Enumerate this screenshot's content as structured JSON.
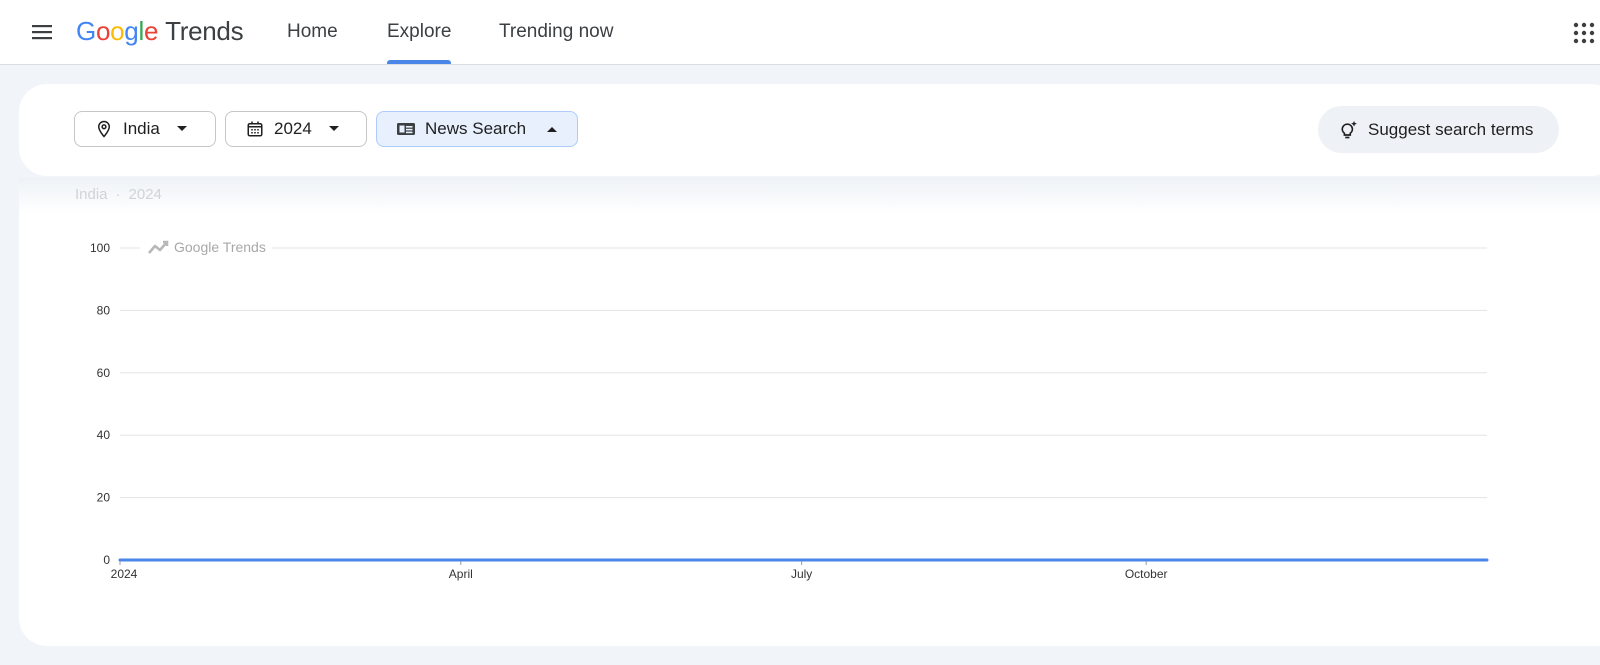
{
  "header": {
    "logo_brand": "Google",
    "logo_product": "Trends",
    "tabs": [
      {
        "label": "Home",
        "active": false
      },
      {
        "label": "Explore",
        "active": true
      },
      {
        "label": "Trending now",
        "active": false
      }
    ]
  },
  "filters": {
    "location": "India",
    "time_range": "2024",
    "search_type": "News Search",
    "suggest_label": "Suggest search terms"
  },
  "results": {
    "context_location": "India",
    "context_separator": "·",
    "context_time": "2024"
  },
  "chart_data": {
    "type": "line",
    "watermark": "Google Trends",
    "x_tick_labels": [
      "2024",
      "April",
      "July",
      "October"
    ],
    "x_tick_dates": [
      "2024-01-01",
      "2024-04-01",
      "2024-07-01",
      "2024-10-01"
    ],
    "xlim": [
      "2024-01-01",
      "2024-12-31"
    ],
    "y_ticks": [
      0,
      20,
      40,
      60,
      80,
      100
    ],
    "ylim": [
      0,
      100
    ],
    "grid": true,
    "series": [
      {
        "x": [
          "2024-01-01",
          "2024-12-31"
        ],
        "values": [
          0,
          0
        ],
        "color": "#4a86e8"
      }
    ]
  },
  "colors": {
    "accent": "#4a86e8",
    "google_blue": "#4285f4",
    "google_red": "#ea4335",
    "google_yellow": "#fbbc05",
    "google_green": "#34a853"
  }
}
